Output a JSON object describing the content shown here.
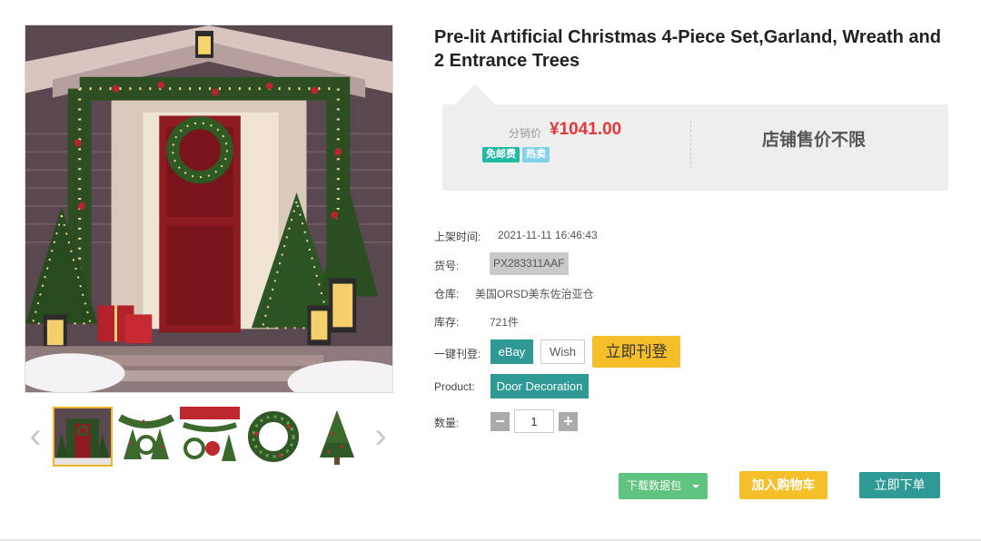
{
  "product": {
    "title": "Pre-lit Artificial Christmas 4-Piece Set,Garland, Wreath and 2 Entrance Trees"
  },
  "price_panel": {
    "label": "分销价",
    "price": "¥1041.00",
    "tags": [
      "免邮费",
      "热卖"
    ],
    "store_price_text": "店铺售价不限"
  },
  "info": {
    "listed_label": "上架时间:",
    "listed_value": "2021-11-11 16:46:43",
    "sku_label": "货号:",
    "sku_value": "PX283311AAF",
    "warehouse_label": "仓库:",
    "warehouse_value": "美国ORSD美东佐治亚仓",
    "stock_label": "库存:",
    "stock_value": "721件",
    "publish_label": "一键刊登:",
    "platforms": [
      "eBay",
      "Wish"
    ],
    "publish_button": "立即刊登",
    "product_label": "Product:",
    "product_value": "Door Decoration",
    "quantity_label": "数量:",
    "quantity_value": "1",
    "minus": "−",
    "plus": "+"
  },
  "actions": {
    "download": "下载数据包",
    "add_to_cart": "加入购物车",
    "order_now": "立即下单"
  },
  "gallery": {
    "prev": "‹",
    "next": "›",
    "thumbnails": [
      "door-set",
      "garland-trees",
      "set-components",
      "wreath",
      "tree"
    ]
  },
  "colors": {
    "accent_teal": "#2f9a95",
    "accent_yellow": "#f5bf2a",
    "price_red": "#e5383b",
    "download_green": "#5ec47f"
  }
}
